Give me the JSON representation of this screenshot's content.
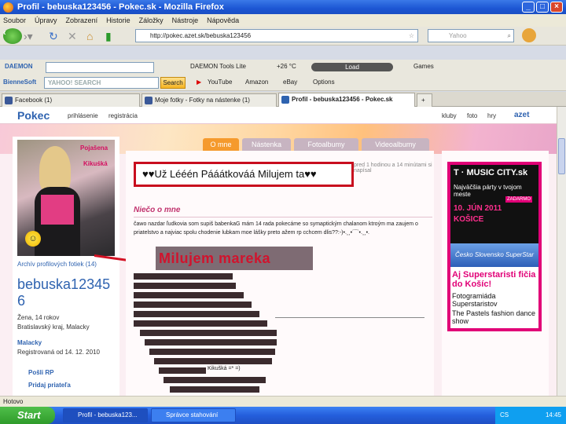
{
  "window": {
    "title": "Profil - bebuska123456 - Pokec.sk - Mozilla Firefox"
  },
  "menu": [
    "Soubor",
    "Úpravy",
    "Zobrazení",
    "Historie",
    "Záložky",
    "Nástroje",
    "Nápověda"
  ],
  "nav": {
    "url": "http://pokec.azet.sk/bebuska123456",
    "search_placeholder": "Yahoo"
  },
  "toolbar2": {
    "daemon": "DAEMON Tools Lite",
    "temp": "+26 °C",
    "load": "Load",
    "games": "Games"
  },
  "toolbar3": {
    "brand": "BienneSoft",
    "yahoo_placeholder": "YAHOO! SEARCH",
    "search_btn": "Search",
    "youtube": "YouTube",
    "amazon": "Amazon",
    "ebay": "eBay",
    "options": "Options"
  },
  "tabs": [
    {
      "label": "Facebook (1)"
    },
    {
      "label": "Moje fotky - Fotky na nástenke (1)"
    },
    {
      "label": "Profil - bebuska123456 - Pokec.sk"
    }
  ],
  "pokec": {
    "logo": "Pokec",
    "links": [
      "prihlásenie",
      "registrácia"
    ],
    "right_links": [
      "kluby",
      "foto",
      "hry"
    ],
    "azet": "azet"
  },
  "profile_tabs": [
    "O mne",
    "Nástenka",
    "Fotoalbumy",
    "Videoalbumy"
  ],
  "left": {
    "photo_text1": "Pojašena",
    "photo_text2": "Kikuśká",
    "archive": "Archív profilových fotiek (14)",
    "username": "bebuska123456",
    "info": "Žena, 14 rokov",
    "location": "Bratislavský kraj, Malacky",
    "city_link": "Malacky",
    "registered": "Registrovaná od 14. 12. 2010",
    "send_msg": "Pošli RP",
    "add_friend": "Pridaj priateľa"
  },
  "status": {
    "text": "♥♥Už Lééén Pááátkováá Milujem ta♥♥",
    "time": "pred 1 hodinou a 14 minútami si napísal"
  },
  "about": {
    "heading": "Niečo o mne",
    "text": "čawo nazdar ľudkovia som supiš babenkaG mám 14 rada pokecáme so symaptickým chalanom ktroým ma zaujem o priatelstvo a najviac spolu chodenie lubkam moe lášky preto ažem rp cchcem dlis??:-)•.¸¸•´¯`•.¸¸•.",
    "overlay": "Milujem mareka",
    "kiku": "Kikušká =* =)"
  },
  "ad": {
    "top": "T · MUSIC CITY.sk",
    "line1": "Najväčšia párty v tvojom meste",
    "date": "10. JÚN 2011",
    "city": "KOŠICE",
    "zdarma": "ZADARMO",
    "superstar": "Česko Slovensko SuperStar",
    "headline": "Aj Superstaristi fičia do Košíc!",
    "sub1": "Fotogramiáda Superstaristov",
    "sub2": "The Pastels fashion dance show"
  },
  "statusbar": {
    "text": "Hotovo"
  },
  "taskbar": {
    "start": "Start",
    "items": [
      "Profil - bebuska123...",
      "Správce stahování"
    ],
    "lang": "CS",
    "time": "14:45"
  },
  "colors": {
    "pokec_blue": "#2f63b0",
    "accent_red": "#c80d1e",
    "magenta": "#e10077",
    "orange": "#f59a2d"
  }
}
